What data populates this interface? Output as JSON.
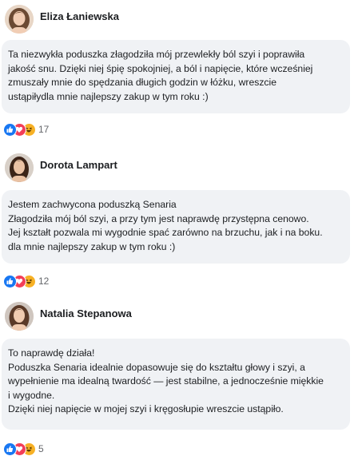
{
  "comments": [
    {
      "author": "Eliza Łaniewska",
      "lines": [
        "Ta niezwykła poduszka złagodziła mój przewlekły ból szyi i poprawiła",
        "jakość snu. Dzięki niej śpię spokojniej, a ból i napięcie, które wcześniej",
        "zmuszały mnie do spędzania długich godzin w łóżku, wreszcie",
        "ustąpiłydla mnie najlepszy zakup w tym roku :)"
      ],
      "reaction_count": "17"
    },
    {
      "author": "Dorota Lampart",
      "lines": [
        "Jestem zachwycona poduszką Senaria",
        "Złagodziła mój ból szyi, a przy tym jest naprawdę przystępna cenowo.",
        "Jej kształt pozwala mi wygodnie spać zarówno na brzuchu, jak i na boku.",
        "dla mnie najlepszy zakup w tym roku :)"
      ],
      "reaction_count": "12"
    },
    {
      "author": "Natalia Stepanowa",
      "lines": [
        "To naprawdę działa!",
        "Poduszka Senaria idealnie dopasowuje się do kształtu głowy i szyi, a",
        "wypełnienie ma idealną twardość — jest stabilne, a jednocześnie miękkie",
        "i wygodne.",
        "Dzięki niej napięcie w mojej szyi i kręgosłupie wreszcie ustąpiło."
      ],
      "reaction_count": "5"
    }
  ],
  "colors": {
    "like": "#1877f2",
    "love": "#f33e58",
    "haha": "#f7b125",
    "bubble": "#f0f2f5",
    "text": "#1c1e21",
    "muted": "#65676b"
  },
  "icons": [
    "avatar",
    "like-icon",
    "love-icon",
    "haha-icon"
  ]
}
